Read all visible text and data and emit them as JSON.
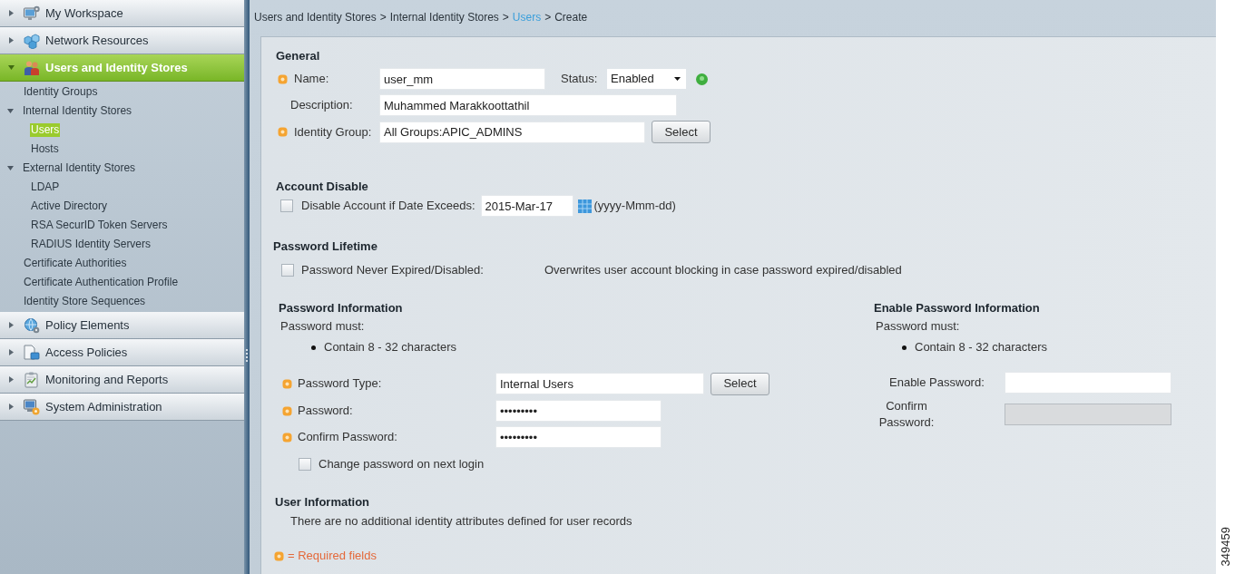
{
  "sidebar": {
    "sections": [
      {
        "label": "My Workspace",
        "expanded": false,
        "selected": false
      },
      {
        "label": "Network Resources",
        "expanded": false,
        "selected": false
      },
      {
        "label": "Users and Identity Stores",
        "expanded": true,
        "selected": true,
        "children": [
          {
            "label": "Identity Groups",
            "selected": false
          },
          {
            "label": "Internal Identity Stores",
            "expanded": true,
            "selected": false,
            "children": [
              {
                "label": "Users",
                "selected": true
              },
              {
                "label": "Hosts",
                "selected": false
              }
            ]
          },
          {
            "label": "External Identity Stores",
            "expanded": true,
            "selected": false,
            "children": [
              {
                "label": "LDAP",
                "selected": false
              },
              {
                "label": "Active Directory",
                "selected": false
              },
              {
                "label": "RSA SecurID Token Servers",
                "selected": false
              },
              {
                "label": "RADIUS Identity Servers",
                "selected": false
              }
            ]
          },
          {
            "label": "Certificate Authorities",
            "selected": false
          },
          {
            "label": "Certificate Authentication Profile",
            "selected": false
          },
          {
            "label": "Identity Store Sequences",
            "selected": false
          }
        ]
      },
      {
        "label": "Policy Elements",
        "expanded": false,
        "selected": false
      },
      {
        "label": "Access Policies",
        "expanded": false,
        "selected": false
      },
      {
        "label": "Monitoring and Reports",
        "expanded": false,
        "selected": false
      },
      {
        "label": "System Administration",
        "expanded": false,
        "selected": false
      }
    ]
  },
  "breadcrumb": [
    {
      "label": "Users and Identity Stores",
      "link": false,
      "separator": ">"
    },
    {
      "label": "Internal Identity Stores",
      "link": false,
      "separator": ">"
    },
    {
      "label": "Users",
      "link": true,
      "separator": ">"
    },
    {
      "label": "Create",
      "link": false
    }
  ],
  "general": {
    "title": "General",
    "name": {
      "label": "Name:",
      "value": "user_mm",
      "required": true
    },
    "status": {
      "label": "Status:",
      "value": "Enabled"
    },
    "description": {
      "label": "Description:",
      "value": "Muhammed Marakkoottathil",
      "required": false
    },
    "identity_group": {
      "label": "Identity Group:",
      "value": "All Groups:APIC_ADMINS",
      "required": true,
      "button": "Select"
    }
  },
  "account_disable": {
    "title": "Account Disable",
    "checkbox": {
      "label": "Disable Account if Date Exceeds:",
      "checked": false
    },
    "date": {
      "value": "2015-Mar-17"
    },
    "format_hint": "(yyyy-Mmm-dd)"
  },
  "password_lifetime": {
    "title": "Password Lifetime",
    "checkbox": {
      "label": "Password Never Expired/Disabled:",
      "checked": false
    },
    "note": "Overwrites user account blocking in case password expired/disabled"
  },
  "password_information": {
    "title": "Password Information",
    "rules_intro": "Password must:",
    "rules": [
      "Contain 8 - 32 characters"
    ],
    "fields": [
      {
        "label": "Password Type:",
        "value": "Internal Users",
        "required": true,
        "button": "Select"
      },
      {
        "label": "Password:",
        "value": "•••••••••",
        "required": true
      },
      {
        "label": "Confirm Password:",
        "value": "•••••••••",
        "required": true
      }
    ],
    "change_on_next_login": {
      "label": "Change password on next login",
      "checked": false
    }
  },
  "enable_password_information": {
    "title": "Enable Password Information",
    "rules_intro": "Password must:",
    "rules": [
      "Contain 8 - 32 characters"
    ],
    "fields": [
      {
        "label": "Enable Password:",
        "disabled": false
      },
      {
        "label": "Confirm Password:",
        "disabled": true
      }
    ]
  },
  "user_information": {
    "title": "User Information",
    "message": "There are no additional identity attributes defined for user records"
  },
  "legend": {
    "text": "= Required fields"
  },
  "figure_id": "349459"
}
